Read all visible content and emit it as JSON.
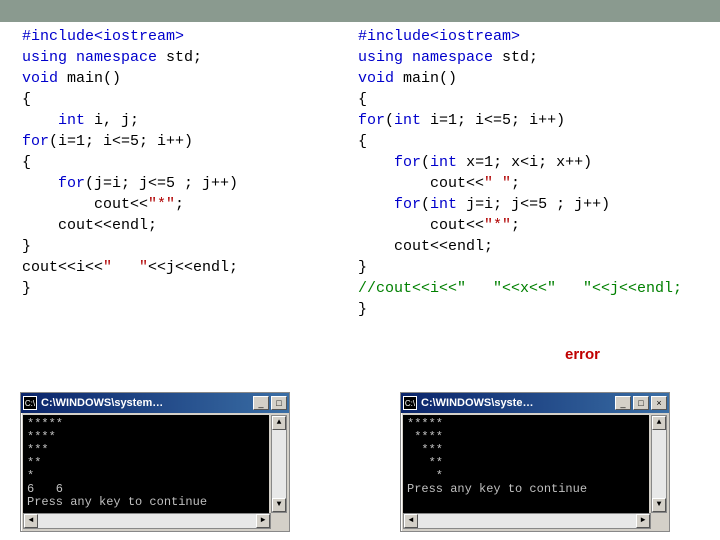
{
  "codeLeft": [
    {
      "segs": [
        {
          "cls": "pp",
          "t": "#include<iostream>"
        }
      ]
    },
    {
      "segs": [
        {
          "cls": "kw",
          "t": "using"
        },
        {
          "cls": "",
          "t": " "
        },
        {
          "cls": "kw",
          "t": "namespace"
        },
        {
          "cls": "",
          "t": " std;"
        }
      ]
    },
    {
      "segs": [
        {
          "cls": "kw",
          "t": "void"
        },
        {
          "cls": "",
          "t": " main()"
        }
      ]
    },
    {
      "segs": [
        {
          "cls": "",
          "t": "{"
        }
      ]
    },
    {
      "segs": [
        {
          "cls": "",
          "t": "    "
        },
        {
          "cls": "kw",
          "t": "int"
        },
        {
          "cls": "",
          "t": " i, j;"
        }
      ]
    },
    {
      "segs": [
        {
          "cls": "kw",
          "t": "for"
        },
        {
          "cls": "",
          "t": "(i=1; i<=5; i++)"
        }
      ]
    },
    {
      "segs": [
        {
          "cls": "",
          "t": "{"
        }
      ]
    },
    {
      "segs": [
        {
          "cls": "",
          "t": "    "
        },
        {
          "cls": "kw",
          "t": "for"
        },
        {
          "cls": "",
          "t": "(j=i; j<=5 ; j++)"
        }
      ]
    },
    {
      "segs": [
        {
          "cls": "",
          "t": "        cout<<"
        },
        {
          "cls": "str",
          "t": "\"*\""
        },
        {
          "cls": "",
          "t": ";"
        }
      ]
    },
    {
      "segs": [
        {
          "cls": "",
          "t": "    cout<<endl;"
        }
      ]
    },
    {
      "segs": [
        {
          "cls": "",
          "t": ""
        }
      ]
    },
    {
      "segs": [
        {
          "cls": "",
          "t": "}"
        }
      ]
    },
    {
      "segs": [
        {
          "cls": "",
          "t": "cout<<i<<"
        },
        {
          "cls": "str",
          "t": "\"   \""
        },
        {
          "cls": "",
          "t": "<<j<<endl;"
        }
      ]
    },
    {
      "segs": [
        {
          "cls": "",
          "t": "}"
        }
      ]
    }
  ],
  "codeRight": [
    {
      "segs": [
        {
          "cls": "pp",
          "t": "#include<iostream>"
        }
      ]
    },
    {
      "segs": [
        {
          "cls": "kw",
          "t": "using"
        },
        {
          "cls": "",
          "t": " "
        },
        {
          "cls": "kw",
          "t": "namespace"
        },
        {
          "cls": "",
          "t": " std;"
        }
      ]
    },
    {
      "segs": [
        {
          "cls": "kw",
          "t": "void"
        },
        {
          "cls": "",
          "t": " main()"
        }
      ]
    },
    {
      "segs": [
        {
          "cls": "",
          "t": "{"
        }
      ]
    },
    {
      "segs": [
        {
          "cls": "kw",
          "t": "for"
        },
        {
          "cls": "",
          "t": "("
        },
        {
          "cls": "kw",
          "t": "int"
        },
        {
          "cls": "",
          "t": " i=1; i<=5; i++)"
        }
      ]
    },
    {
      "segs": [
        {
          "cls": "",
          "t": "{"
        }
      ]
    },
    {
      "segs": [
        {
          "cls": "",
          "t": "    "
        },
        {
          "cls": "kw",
          "t": "for"
        },
        {
          "cls": "",
          "t": "("
        },
        {
          "cls": "kw",
          "t": "int"
        },
        {
          "cls": "",
          "t": " x=1; x<i; x++)"
        }
      ]
    },
    {
      "segs": [
        {
          "cls": "",
          "t": "        cout<<"
        },
        {
          "cls": "str",
          "t": "\" \""
        },
        {
          "cls": "",
          "t": ";"
        }
      ]
    },
    {
      "segs": [
        {
          "cls": "",
          "t": "    "
        },
        {
          "cls": "kw",
          "t": "for"
        },
        {
          "cls": "",
          "t": "("
        },
        {
          "cls": "kw",
          "t": "int"
        },
        {
          "cls": "",
          "t": " j=i; j<=5 ; j++)"
        }
      ]
    },
    {
      "segs": [
        {
          "cls": "",
          "t": "        cout<<"
        },
        {
          "cls": "str",
          "t": "\"*\""
        },
        {
          "cls": "",
          "t": ";"
        }
      ]
    },
    {
      "segs": [
        {
          "cls": "",
          "t": "    cout<<endl;"
        }
      ]
    },
    {
      "segs": [
        {
          "cls": "",
          "t": ""
        }
      ]
    },
    {
      "segs": [
        {
          "cls": "",
          "t": "}"
        }
      ]
    },
    {
      "segs": [
        {
          "cls": "cmt",
          "t": "//cout<<i<<\"   \"<<x<<\"   \"<<j<<endl;"
        }
      ]
    },
    {
      "segs": [
        {
          "cls": "",
          "t": "}"
        }
      ]
    }
  ],
  "errorLabel": "error",
  "consoleLeft": {
    "iconText": "C:\\",
    "title": "C:\\WINDOWS\\system…",
    "btnMin": "_",
    "btnMax": "□",
    "output": "*****\n****\n***\n**\n*\n6   6\nPress any key to continue",
    "arrowUp": "▲",
    "arrowDown": "▼",
    "arrowLeft": "◄",
    "arrowRight": "►"
  },
  "consoleRight": {
    "iconText": "C:\\",
    "title": "C:\\WINDOWS\\syste…",
    "btnMin": "_",
    "btnMax": "□",
    "btnClose": "×",
    "output": "*****\n ****\n  ***\n   **\n    *\nPress any key to continue",
    "arrowUp": "▲",
    "arrowDown": "▼",
    "arrowLeft": "◄",
    "arrowRight": "►"
  }
}
